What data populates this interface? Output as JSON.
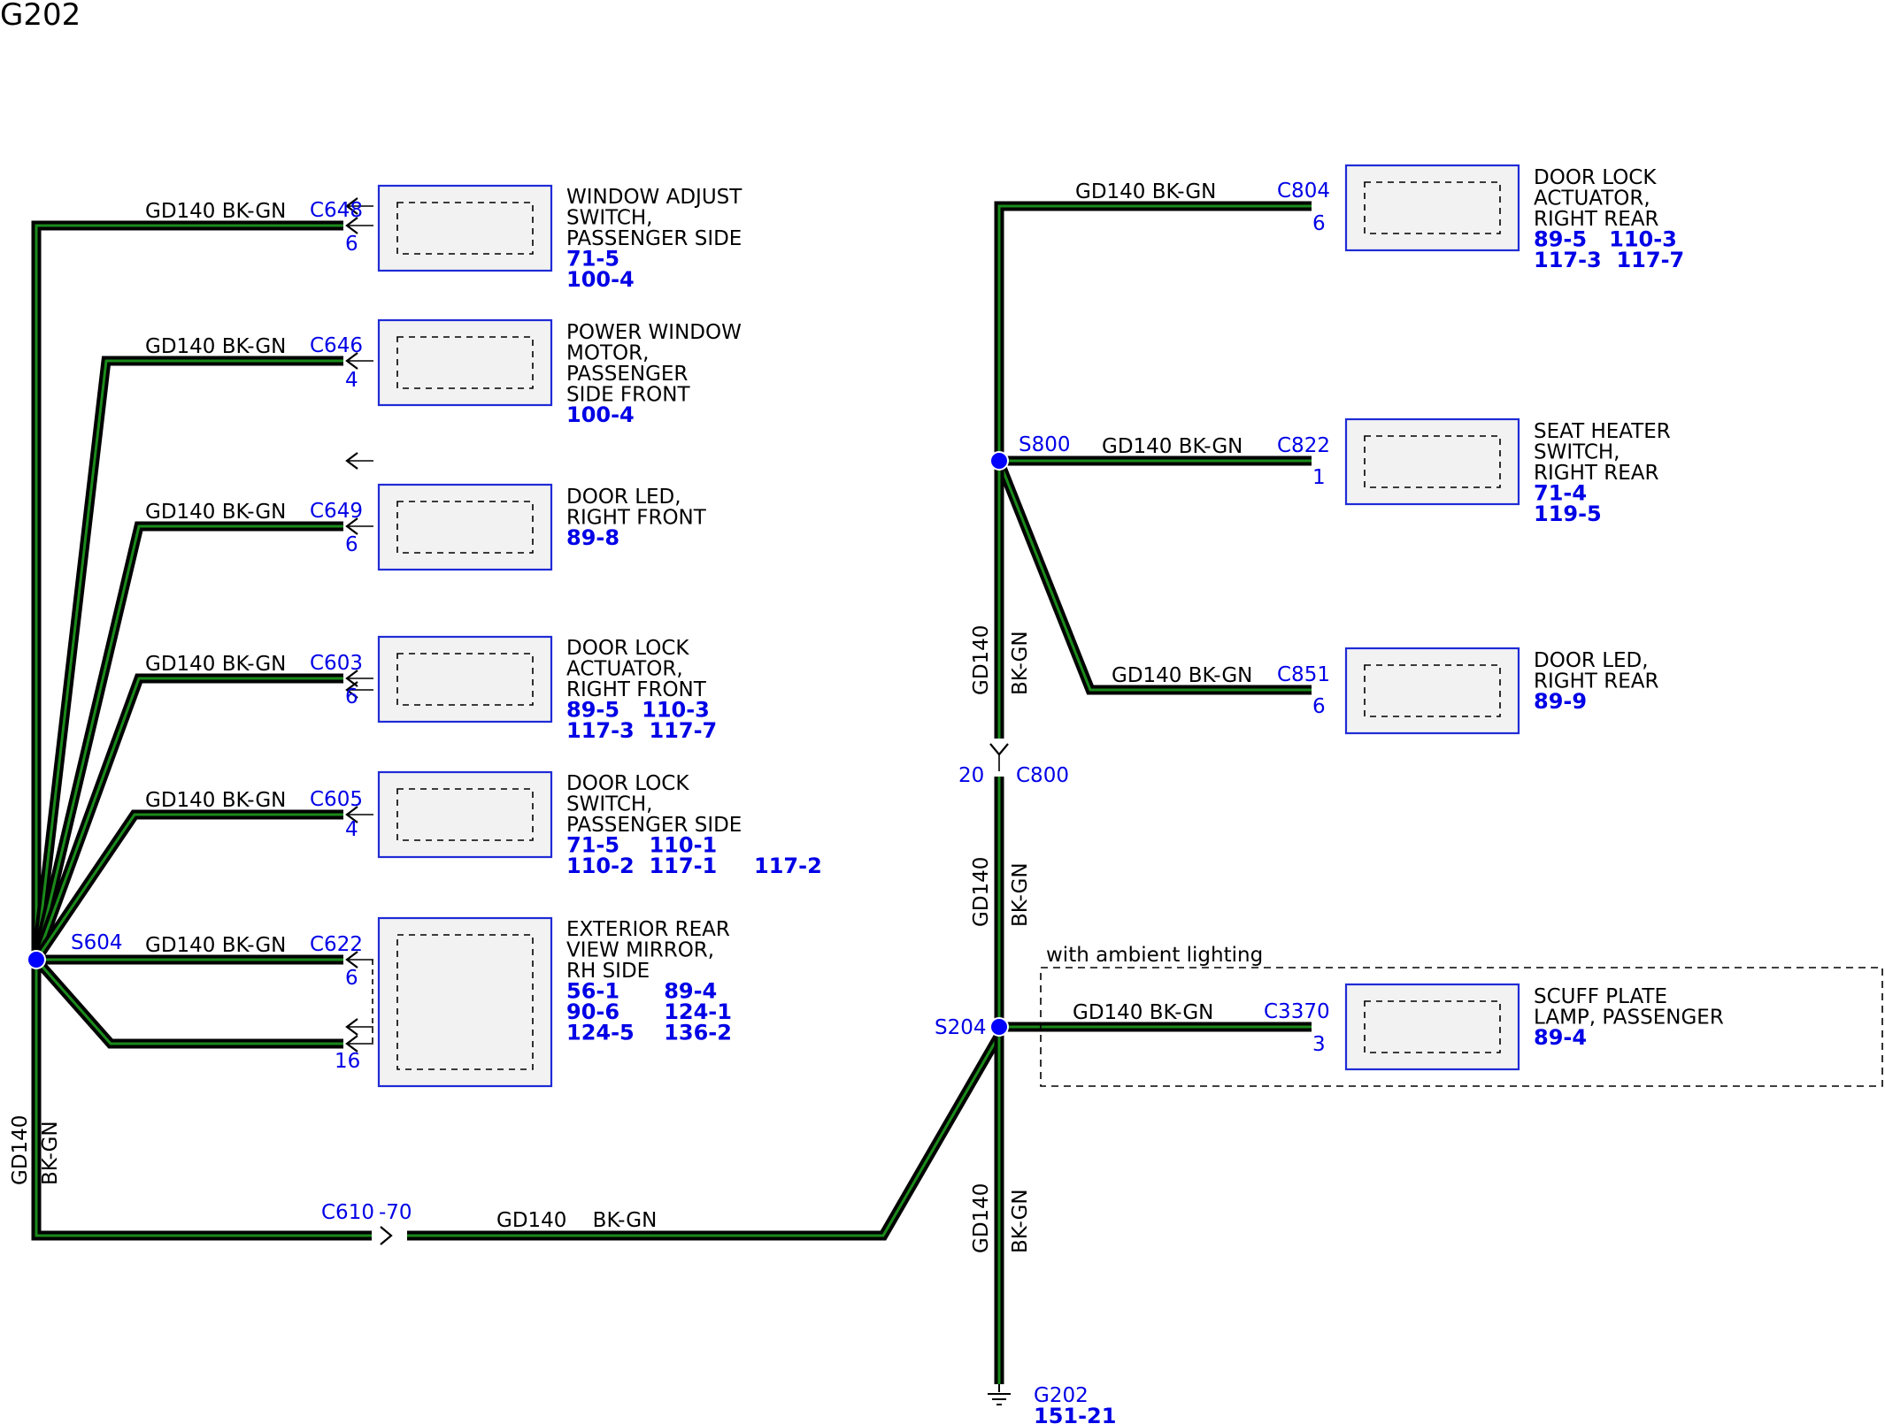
{
  "title": "G202",
  "wire": {
    "circuit": "GD140",
    "color": "BK-GN"
  },
  "splices": {
    "s604": "S604",
    "s800": "S800",
    "s204": "S204"
  },
  "ground": {
    "name": "G202",
    "ref": "151-21"
  },
  "inline": {
    "c610": {
      "id": "C610",
      "pin": "-70"
    },
    "c800": {
      "id": "C800",
      "pin": "20"
    }
  },
  "option_note": "with ambient lighting",
  "components": [
    {
      "conn": "C648",
      "pins": [
        "6"
      ],
      "name": [
        "WINDOW ADJUST",
        "SWITCH,",
        "PASSENGER SIDE"
      ],
      "refs": [
        "71-5",
        "100-4"
      ]
    },
    {
      "conn": "C646",
      "pins": [
        "4"
      ],
      "name": [
        "POWER WINDOW",
        "MOTOR,",
        "PASSENGER",
        "SIDE FRONT"
      ],
      "refs": [
        "100-4"
      ]
    },
    {
      "conn": "C649",
      "pins": [
        "6"
      ],
      "name": [
        "DOOR LED,",
        "RIGHT FRONT"
      ],
      "refs": [
        "89-8"
      ]
    },
    {
      "conn": "C603",
      "pins": [
        "6"
      ],
      "name": [
        "DOOR LOCK",
        "ACTUATOR,",
        "RIGHT FRONT"
      ],
      "refs": [
        "89-5   110-3",
        "117-3  117-7"
      ]
    },
    {
      "conn": "C605",
      "pins": [
        "4"
      ],
      "name": [
        "DOOR LOCK",
        "SWITCH,",
        "PASSENGER SIDE"
      ],
      "refs": [
        "71-5    110-1",
        "110-2  117-1     117-2"
      ]
    },
    {
      "conn": "C622",
      "pins": [
        "6",
        "16"
      ],
      "name": [
        "EXTERIOR REAR",
        "VIEW MIRROR,",
        "RH SIDE"
      ],
      "refs": [
        "56-1      89-4",
        "90-6      124-1",
        "124-5    136-2"
      ]
    },
    {
      "conn": "C804",
      "pins": [
        "6"
      ],
      "name": [
        "DOOR LOCK",
        "ACTUATOR,",
        "RIGHT REAR"
      ],
      "refs": [
        "89-5   110-3",
        "117-3  117-7"
      ]
    },
    {
      "conn": "C822",
      "pins": [
        "1"
      ],
      "name": [
        "SEAT HEATER",
        "SWITCH,",
        "RIGHT REAR"
      ],
      "refs": [
        "71-4",
        "119-5"
      ]
    },
    {
      "conn": "C851",
      "pins": [
        "6"
      ],
      "name": [
        "DOOR LED,",
        "RIGHT REAR"
      ],
      "refs": [
        "89-9"
      ]
    },
    {
      "conn": "C3370",
      "pins": [
        "3"
      ],
      "name": [
        "SCUFF PLATE",
        "LAMP, PASSENGER"
      ],
      "refs": [
        "89-4"
      ]
    }
  ]
}
